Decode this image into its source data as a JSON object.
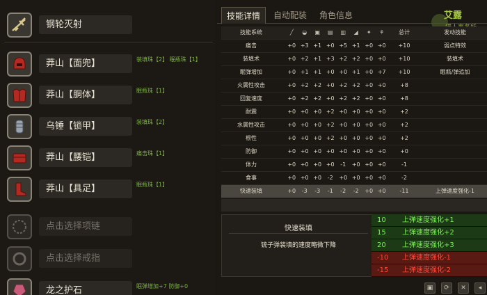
{
  "weapon": {
    "name": "钢轮灭射"
  },
  "armor": [
    {
      "name": "莽山【面兜】",
      "deco": "装填珠【2】 眠瓶珠【1】"
    },
    {
      "name": "莽山【胴体】",
      "deco": "眠瓶珠【1】"
    },
    {
      "name": "乌锤【锁甲】",
      "deco": "装填珠【2】"
    },
    {
      "name": "莽山【腰铠】",
      "deco": "痛击珠【1】"
    },
    {
      "name": "莽山【具足】",
      "deco": "眠瓶珠【1】"
    }
  ],
  "accessories": [
    {
      "name": "点击选择项链"
    },
    {
      "name": "点击选择戒指"
    }
  ],
  "charm": {
    "name": "龙之护石",
    "deco": "眠弹增加+7 防御+0"
  },
  "tabs": [
    {
      "label": "技能详情",
      "active": true
    },
    {
      "label": "自动配装",
      "active": false
    },
    {
      "label": "角色信息",
      "active": false
    }
  ],
  "logo": {
    "text1": "艾露",
    "text2": "猎人事务所"
  },
  "table": {
    "header": {
      "skill_col": "技能系统",
      "total": "总计",
      "effect": "发动技能",
      "icons": [
        "weapon-icon",
        "helm-icon",
        "chest-icon",
        "arms-icon",
        "waist-icon",
        "legs-icon",
        "charm-icon",
        "deco-icon"
      ]
    },
    "rows": [
      {
        "skill": "痛击",
        "vals": [
          "+0",
          "+3",
          "+1",
          "+0",
          "+5",
          "+1",
          "+0",
          "+0"
        ],
        "total": "+10",
        "effect": "弱点特效"
      },
      {
        "skill": "装填术",
        "vals": [
          "+0",
          "+2",
          "+1",
          "+3",
          "+2",
          "+2",
          "+0",
          "+0"
        ],
        "total": "+10",
        "effect": "装填术"
      },
      {
        "skill": "眠弹增加",
        "vals": [
          "+0",
          "+1",
          "+1",
          "+0",
          "+0",
          "+1",
          "+0",
          "+7"
        ],
        "total": "+10",
        "effect": "眠瓶/弹追加"
      },
      {
        "skill": "火属性攻击",
        "vals": [
          "+0",
          "+2",
          "+2",
          "+0",
          "+2",
          "+2",
          "+0",
          "+0"
        ],
        "total": "+8",
        "effect": ""
      },
      {
        "skill": "回复速度",
        "vals": [
          "+0",
          "+2",
          "+2",
          "+0",
          "+2",
          "+2",
          "+0",
          "+0"
        ],
        "total": "+8",
        "effect": ""
      },
      {
        "skill": "耐震",
        "vals": [
          "+0",
          "+0",
          "+0",
          "+2",
          "+0",
          "+0",
          "+0",
          "+0"
        ],
        "total": "+2",
        "effect": ""
      },
      {
        "skill": "水属性攻击",
        "vals": [
          "+0",
          "+0",
          "+0",
          "+2",
          "+0",
          "+0",
          "+0",
          "+0"
        ],
        "total": "+2",
        "effect": ""
      },
      {
        "skill": "根性",
        "vals": [
          "+0",
          "+0",
          "+0",
          "+2",
          "+0",
          "+0",
          "+0",
          "+0"
        ],
        "total": "+2",
        "effect": ""
      },
      {
        "skill": "防御",
        "vals": [
          "+0",
          "+0",
          "+0",
          "+0",
          "+0",
          "+0",
          "+0",
          "+0"
        ],
        "total": "+0",
        "effect": ""
      },
      {
        "skill": "体力",
        "vals": [
          "+0",
          "+0",
          "+0",
          "+0",
          "-1",
          "+0",
          "+0",
          "+0"
        ],
        "total": "-1",
        "effect": ""
      },
      {
        "skill": "食事",
        "vals": [
          "+0",
          "+0",
          "+0",
          "-2",
          "+0",
          "+0",
          "+0",
          "+0"
        ],
        "total": "-2",
        "effect": ""
      },
      {
        "skill": "快速装填",
        "vals": [
          "+0",
          "-3",
          "-3",
          "-1",
          "-2",
          "-2",
          "+0",
          "+0"
        ],
        "total": "-11",
        "effect": "上弹速度强化-1",
        "highlight": true
      }
    ]
  },
  "info": {
    "title": "快速装填",
    "desc": "铳子弹装填的速度略微下降"
  },
  "effects": [
    {
      "pts": "10",
      "name": "上弹速度强化+1",
      "type": "pos"
    },
    {
      "pts": "15",
      "name": "上弹速度强化+2",
      "type": "pos"
    },
    {
      "pts": "20",
      "name": "上弹速度强化+3",
      "type": "pos"
    },
    {
      "pts": "-10",
      "name": "上弹速度强化-1",
      "type": "neg"
    },
    {
      "pts": "-15",
      "name": "上弹速度强化-2",
      "type": "neg"
    }
  ],
  "toolbar": {
    "icons": [
      "save-icon",
      "load-icon",
      "delete-icon",
      "share-icon"
    ]
  },
  "colors": {
    "background": "#1b1814",
    "deco_green": "#7ab33c",
    "positive_green": "#7ef05a",
    "negative_red": "#ff4a3a"
  }
}
